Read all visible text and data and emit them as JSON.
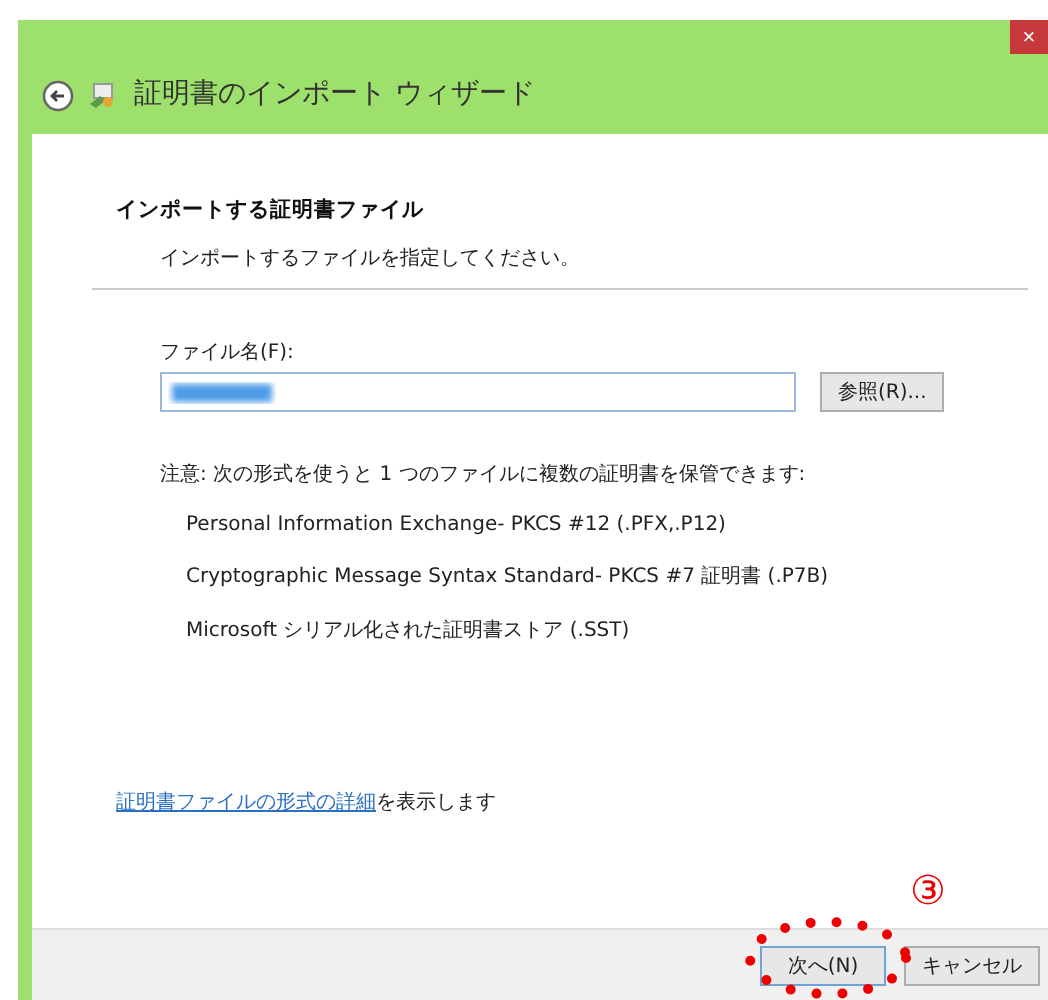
{
  "window": {
    "title": "証明書のインポート ウィザード",
    "close": "×"
  },
  "page": {
    "heading": "インポートする証明書ファイル",
    "subheading": "インポートするファイルを指定してください。"
  },
  "file": {
    "label": "ファイル名(F):",
    "browse": "参照(R)..."
  },
  "note": "注意: 次の形式を使うと 1 つのファイルに複数の証明書を保管できます:",
  "formats": [
    "Personal Information Exchange- PKCS #12 (.PFX,.P12)",
    "Cryptographic Message Syntax Standard- PKCS #7 証明書 (.P7B)",
    "Microsoft シリアル化された証明書ストア (.SST)"
  ],
  "details": {
    "link": "証明書ファイルの形式の詳細",
    "text": "を表示します"
  },
  "buttons": [
    {
      "label": "次へ(N)",
      "kind": "primary",
      "highlighted": true
    },
    {
      "label": "キャンセル",
      "kind": "normal",
      "highlighted": false
    }
  ],
  "annotation": {
    "label": "③"
  }
}
